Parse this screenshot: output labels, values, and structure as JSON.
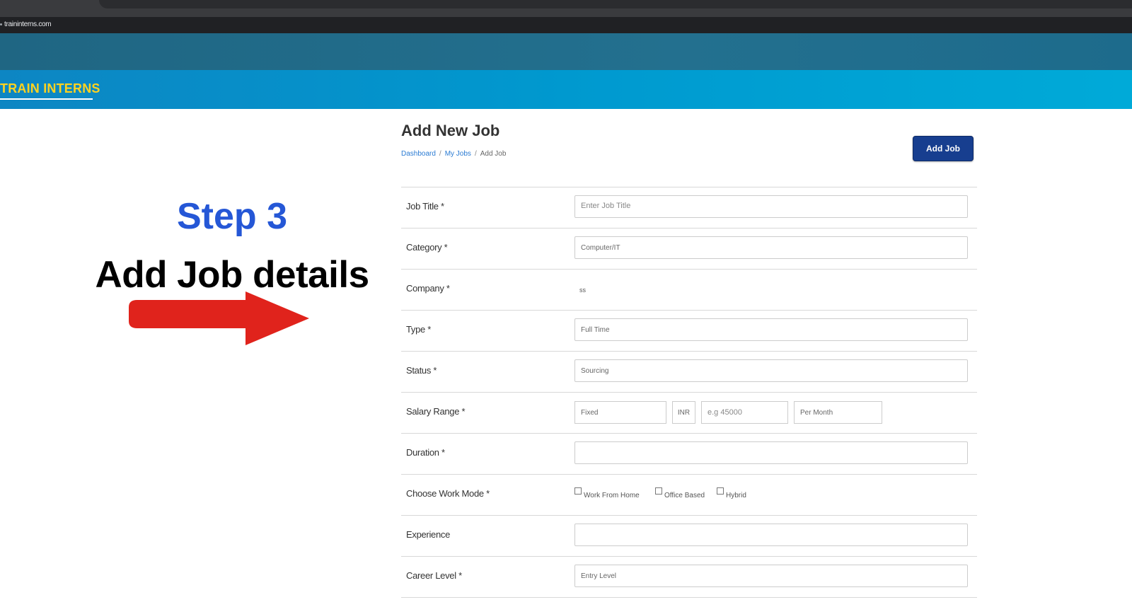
{
  "browser": {
    "url": "traininterns.com"
  },
  "site": {
    "brand": "TRAIN INTERNS"
  },
  "overlay": {
    "step_title": "Step 3",
    "step_subtitle": "Add Job details",
    "arrow_color": "#e0231c"
  },
  "page": {
    "title": "Add New Job",
    "breadcrumb": [
      "Dashboard",
      "My Jobs",
      "Add Job"
    ],
    "add_button": "Add Job"
  },
  "form": {
    "job_title": {
      "label": "Job Title *",
      "placeholder": "Enter Job Title"
    },
    "category": {
      "label": "Category *",
      "value": "Computer/IT"
    },
    "company": {
      "label": "Company *",
      "value": "ss"
    },
    "type": {
      "label": "Type *",
      "value": "Full Time"
    },
    "status": {
      "label": "Status *",
      "value": "Sourcing"
    },
    "salary": {
      "label": "Salary Range *",
      "type": "Fixed",
      "currency": "INR",
      "amount_placeholder": "e.g 45000",
      "period": "Per Month"
    },
    "duration": {
      "label": "Duration *"
    },
    "work_mode": {
      "label": "Choose Work Mode *",
      "options": [
        "Work From Home",
        "Office Based",
        "Hybrid"
      ]
    },
    "experience": {
      "label": "Experience"
    },
    "career_level": {
      "label": "Career Level *",
      "value": "Entry Level"
    }
  },
  "colors": {
    "header": "#23708f",
    "nav": "#0099cf",
    "brand": "#ffd21f",
    "step_blue": "#2557d6",
    "button": "#173e8f"
  }
}
